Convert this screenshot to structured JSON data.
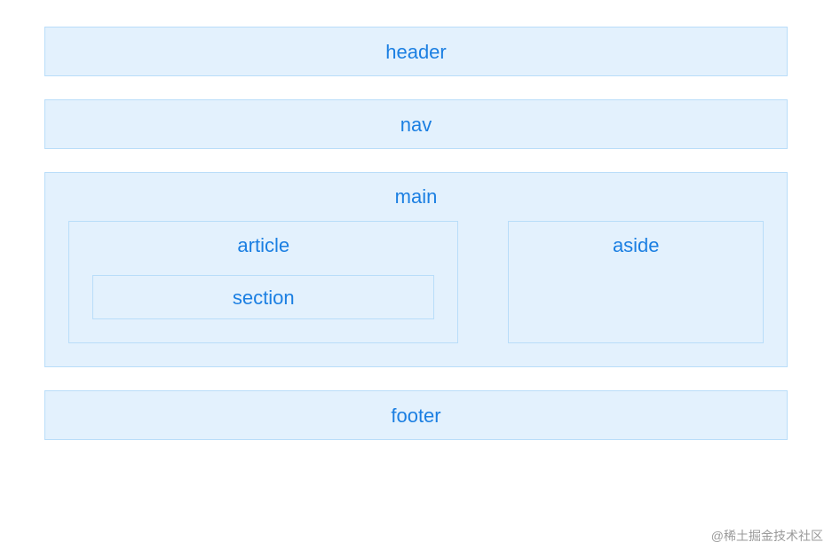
{
  "layout": {
    "header": "header",
    "nav": "nav",
    "main": "main",
    "article": "article",
    "section": "section",
    "aside": "aside",
    "footer": "footer"
  },
  "watermark": "@稀土掘金技术社区"
}
